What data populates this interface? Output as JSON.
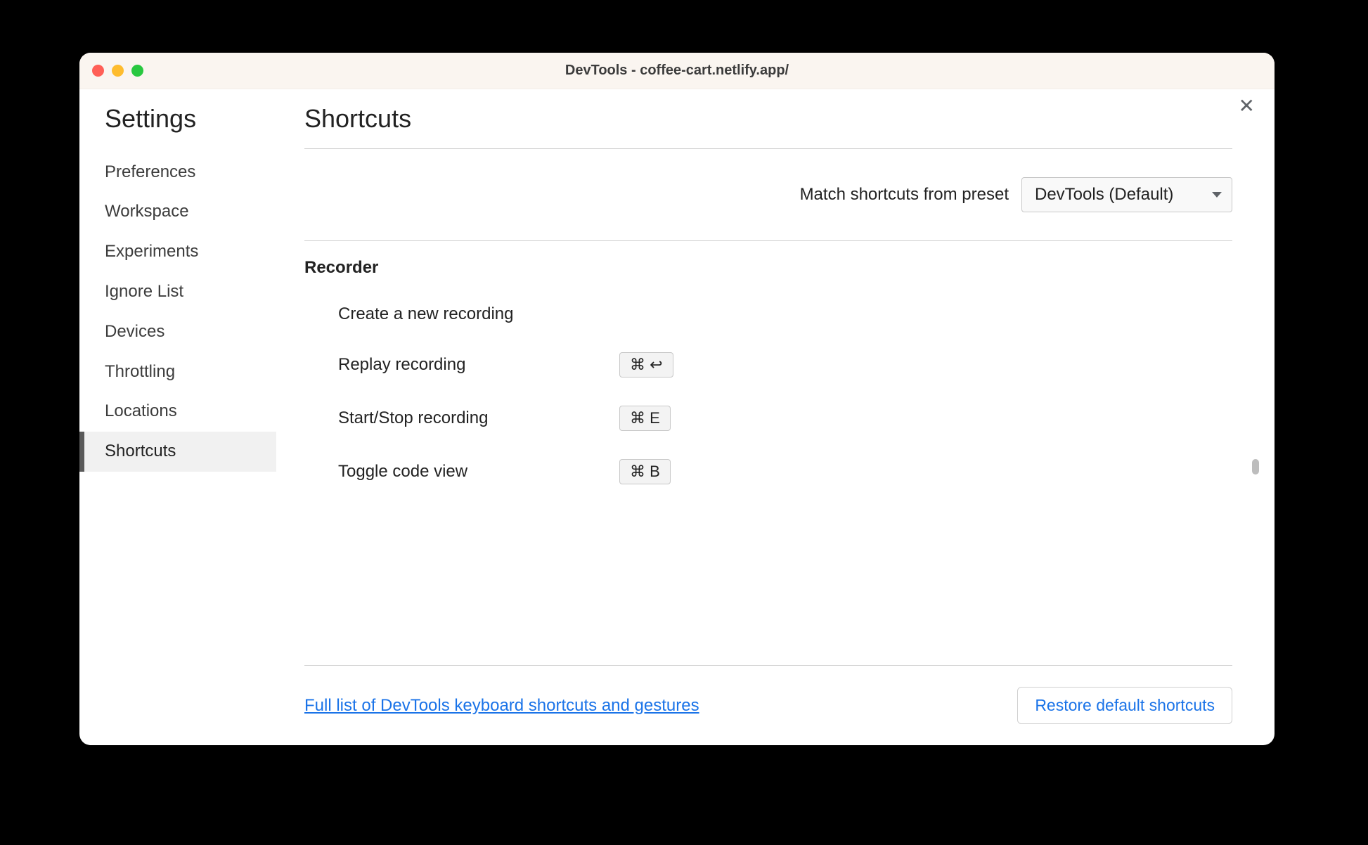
{
  "window": {
    "title": "DevTools - coffee-cart.netlify.app/"
  },
  "sidebar": {
    "title": "Settings",
    "items": [
      {
        "label": "Preferences",
        "selected": false
      },
      {
        "label": "Workspace",
        "selected": false
      },
      {
        "label": "Experiments",
        "selected": false
      },
      {
        "label": "Ignore List",
        "selected": false
      },
      {
        "label": "Devices",
        "selected": false
      },
      {
        "label": "Throttling",
        "selected": false
      },
      {
        "label": "Locations",
        "selected": false
      },
      {
        "label": "Shortcuts",
        "selected": true
      }
    ]
  },
  "main": {
    "title": "Shortcuts",
    "close_glyph": "✕",
    "preset_label": "Match shortcuts from preset",
    "preset_value": "DevTools (Default)",
    "section_title": "Recorder",
    "shortcuts": [
      {
        "label": "Create a new recording",
        "keys": ""
      },
      {
        "label": "Replay recording",
        "keys": "⌘ ↩"
      },
      {
        "label": "Start/Stop recording",
        "keys": "⌘ E"
      },
      {
        "label": "Toggle code view",
        "keys": "⌘ B"
      }
    ],
    "footer_link": "Full list of DevTools keyboard shortcuts and gestures",
    "restore_button": "Restore default shortcuts"
  }
}
